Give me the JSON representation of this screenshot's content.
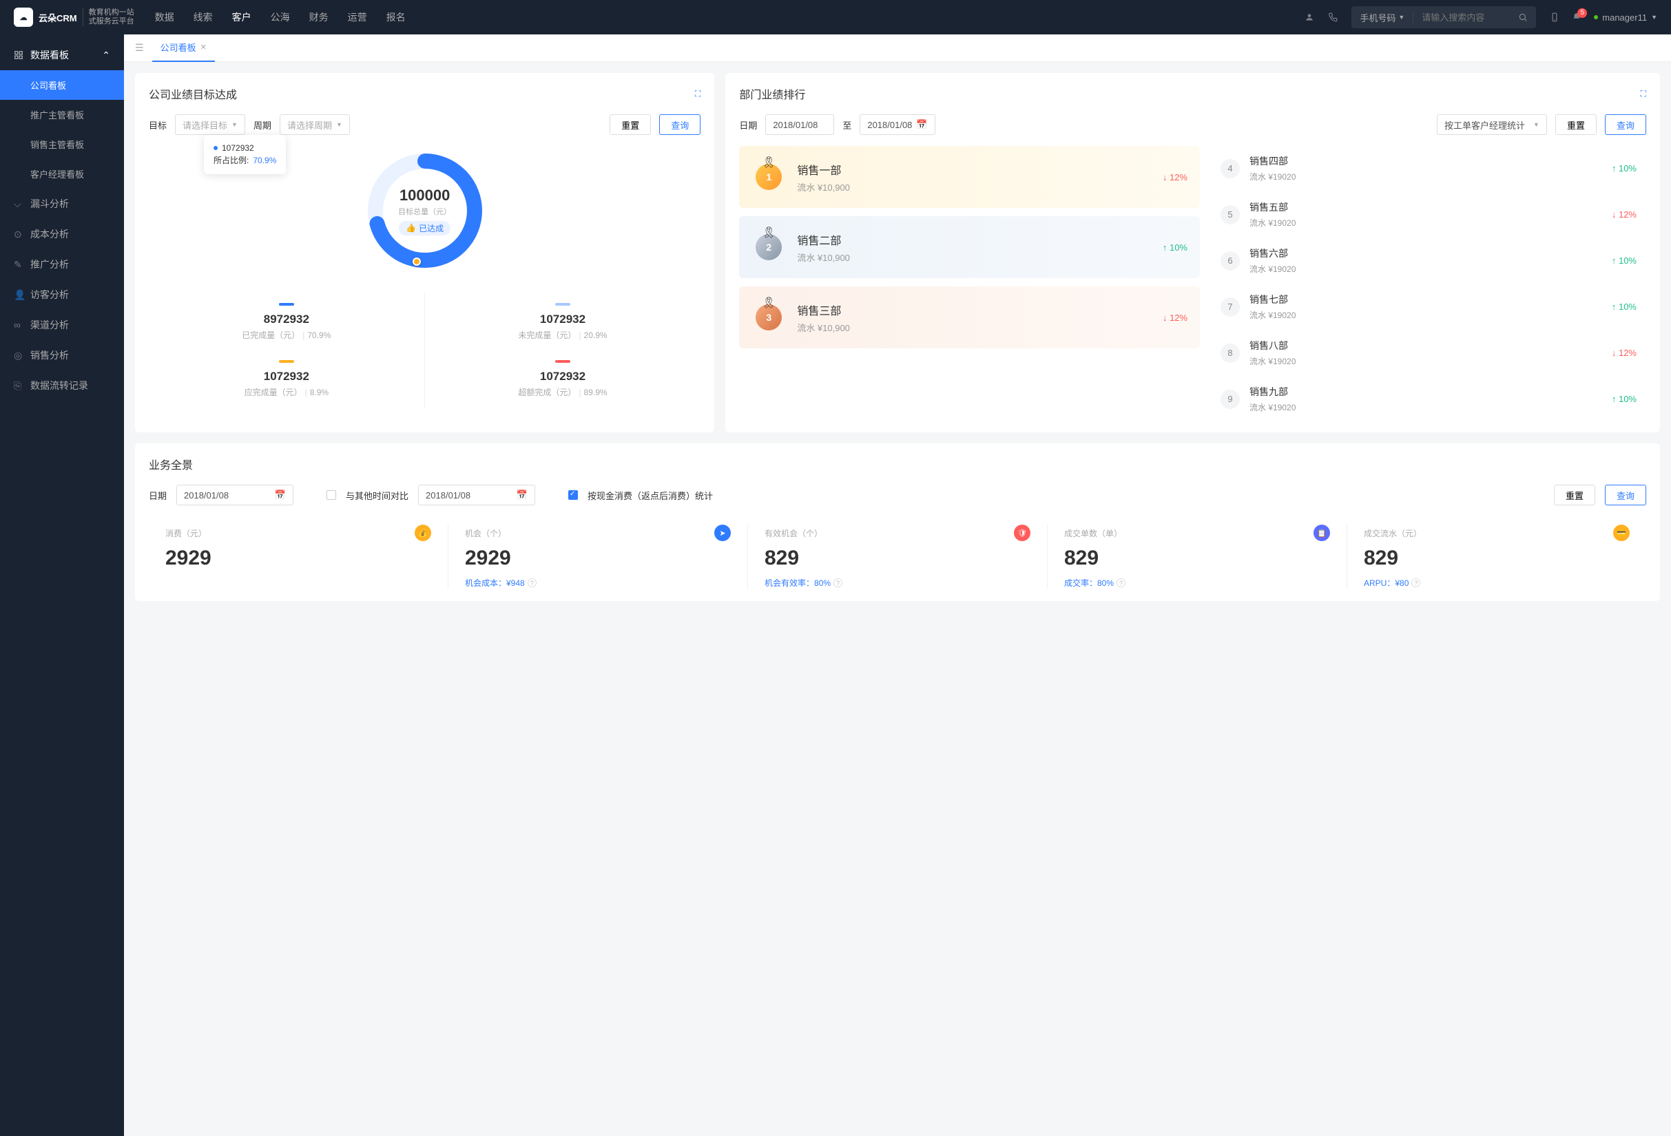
{
  "topnav": {
    "logo_brand": "云朵CRM",
    "logo_sub1": "教育机构一站",
    "logo_sub2": "式服务云平台",
    "items": [
      "数据",
      "线索",
      "客户",
      "公海",
      "财务",
      "运营",
      "报名"
    ],
    "active_index": 2,
    "search_type": "手机号码",
    "search_placeholder": "请输入搜索内容",
    "notif_count": "5",
    "username": "manager11"
  },
  "sidebar": {
    "group": "数据看板",
    "subs": [
      "公司看板",
      "推广主管看板",
      "销售主管看板",
      "客户经理看板"
    ],
    "active_sub": 0,
    "items": [
      "漏斗分析",
      "成本分析",
      "推广分析",
      "访客分析",
      "渠道分析",
      "销售分析",
      "数据流转记录"
    ]
  },
  "tabs": {
    "active": "公司看板"
  },
  "goal_card": {
    "title": "公司业绩目标达成",
    "label_target": "目标",
    "select_target": "请选择目标",
    "label_period": "周期",
    "select_period": "请选择周期",
    "btn_reset": "重置",
    "btn_query": "查询",
    "tooltip_val": "1072932",
    "tooltip_label": "所占比例:",
    "tooltip_pct": "70.9%",
    "center_num": "100000",
    "center_label": "目标总量（元）",
    "center_badge": "已达成",
    "stats": [
      {
        "bar": "bar-blue",
        "num": "8972932",
        "label": "已完成量（元）",
        "pct": "70.9%"
      },
      {
        "bar": "bar-light",
        "num": "1072932",
        "label": "未完成量（元）",
        "pct": "20.9%"
      },
      {
        "bar": "bar-orange",
        "num": "1072932",
        "label": "应完成量（元）",
        "pct": "8.9%"
      },
      {
        "bar": "bar-red",
        "num": "1072932",
        "label": "超额完成（元）",
        "pct": "89.9%"
      }
    ]
  },
  "rank_card": {
    "title": "部门业绩排行",
    "label_date": "日期",
    "date_from": "2018/01/08",
    "date_sep": "至",
    "date_to": "2018/01/08",
    "group_select": "按工单客户经理统计",
    "btn_reset": "重置",
    "btn_query": "查询",
    "top3": [
      {
        "name": "销售一部",
        "sub": "流水 ¥10,900",
        "change": "12%",
        "dir": "down"
      },
      {
        "name": "销售二部",
        "sub": "流水 ¥10,900",
        "change": "10%",
        "dir": "up"
      },
      {
        "name": "销售三部",
        "sub": "流水 ¥10,900",
        "change": "12%",
        "dir": "down"
      }
    ],
    "rest": [
      {
        "n": "4",
        "name": "销售四部",
        "sub": "流水 ¥19020",
        "change": "10%",
        "dir": "up"
      },
      {
        "n": "5",
        "name": "销售五部",
        "sub": "流水 ¥19020",
        "change": "12%",
        "dir": "down"
      },
      {
        "n": "6",
        "name": "销售六部",
        "sub": "流水 ¥19020",
        "change": "10%",
        "dir": "up"
      },
      {
        "n": "7",
        "name": "销售七部",
        "sub": "流水 ¥19020",
        "change": "10%",
        "dir": "up"
      },
      {
        "n": "8",
        "name": "销售八部",
        "sub": "流水 ¥19020",
        "change": "12%",
        "dir": "down"
      },
      {
        "n": "9",
        "name": "销售九部",
        "sub": "流水 ¥19020",
        "change": "10%",
        "dir": "up"
      }
    ]
  },
  "pano_card": {
    "title": "业务全景",
    "label_date": "日期",
    "date1": "2018/01/08",
    "compare_label": "与其他时间对比",
    "date2": "2018/01/08",
    "check_label": "按现金消费（返点后消费）统计",
    "btn_reset": "重置",
    "btn_query": "查询",
    "metrics": [
      {
        "label": "消费（元）",
        "num": "2929",
        "sub": "",
        "icon": "mi-orange"
      },
      {
        "label": "机会（个）",
        "num": "2929",
        "sub": "机会成本：¥948",
        "icon": "mi-blue"
      },
      {
        "label": "有效机会（个）",
        "num": "829",
        "sub": "机会有效率：80%",
        "icon": "mi-red"
      },
      {
        "label": "成交单数（单）",
        "num": "829",
        "sub": "成交率：80%",
        "icon": "mi-purple"
      },
      {
        "label": "成交流水（元）",
        "num": "829",
        "sub": "ARPU：¥80",
        "icon": "mi-yellow"
      }
    ]
  },
  "chart_data": {
    "type": "pie",
    "title": "目标总量（元）",
    "total": 100000,
    "series": [
      {
        "name": "已完成量",
        "value": 8972932,
        "pct": 70.9,
        "color": "#2f7bff"
      },
      {
        "name": "未完成量",
        "value": 1072932,
        "pct": 20.9,
        "color": "#a8c8ff"
      },
      {
        "name": "应完成量",
        "value": 1072932,
        "pct": 8.9,
        "color": "#ffb020"
      },
      {
        "name": "超额完成",
        "value": 1072932,
        "pct": 89.9,
        "color": "#ff5c5c"
      }
    ]
  }
}
